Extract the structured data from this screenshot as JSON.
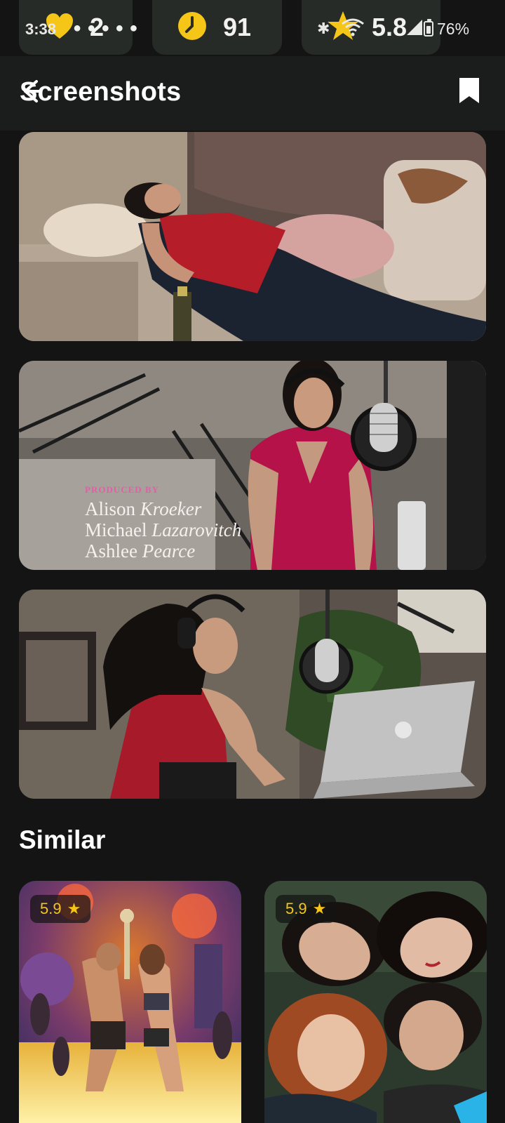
{
  "status_bar": {
    "time": "3:38",
    "pill1_count": "2",
    "pill2_count": "91",
    "pill3_value": "5.8",
    "battery": "76%",
    "icons": [
      "heart-icon",
      "snapchat-ghost-icon",
      "clock-icon",
      "star-icon",
      "bluetooth-icon",
      "wifi-icon",
      "signal-icon",
      "battery-icon"
    ],
    "accent_yellow": "#f5c518"
  },
  "header": {
    "title": "Screenshots",
    "back_icon": "back-arrow-icon",
    "bookmark_icon": "bookmark-icon"
  },
  "screenshots": [
    {
      "id": "shot-1"
    },
    {
      "id": "shot-2",
      "credits": {
        "role": "PRODUCED BY",
        "names": [
          {
            "first": "Alison",
            "last": "Kroeker"
          },
          {
            "first": "Michael",
            "last": "Lazarovitch"
          },
          {
            "first": "Ashlee",
            "last": "Pearce"
          }
        ]
      }
    },
    {
      "id": "shot-3"
    }
  ],
  "similar": {
    "title": "Similar",
    "items": [
      {
        "rating": "5.9"
      },
      {
        "rating": "5.9"
      }
    ]
  }
}
